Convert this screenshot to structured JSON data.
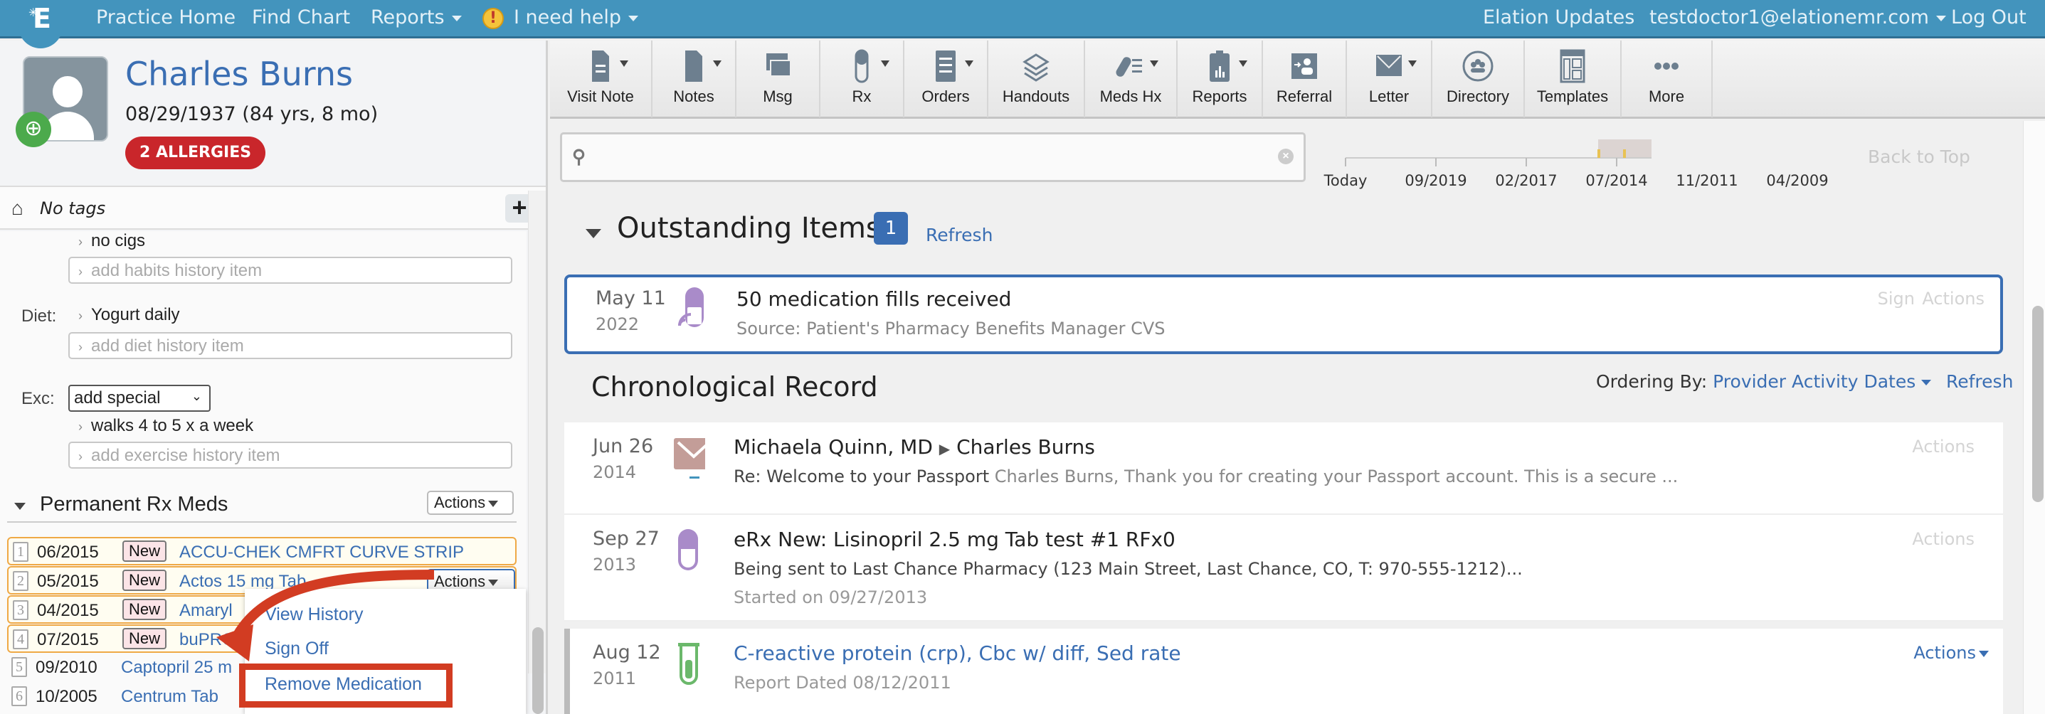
{
  "nav": {
    "logo": "Elation",
    "practice_home": "Practice Home",
    "find_chart": "Find Chart",
    "reports": "Reports",
    "help": "I need help",
    "updates": "Elation Updates",
    "user": "testdoctor1@elationemr.com",
    "logout": "Log Out"
  },
  "patient": {
    "name": "Charles Burns",
    "dob": "08/29/1937 (84 yrs, 8 mo)",
    "allergies": "2 ALLERGIES",
    "tags": "No tags"
  },
  "history": {
    "habits_item": "no cigs",
    "habits_placeholder": "add habits history item",
    "diet_label": "Diet:",
    "diet_item": "Yogurt daily",
    "diet_placeholder": "add diet history item",
    "exc_label": "Exc:",
    "exc_select": "add special",
    "exc_item": "walks 4 to 5 x a week",
    "exc_placeholder": "add exercise history item"
  },
  "rx_meds": {
    "title": "Permanent Rx Meds",
    "actions": "Actions",
    "items": [
      {
        "num": "1",
        "date": "06/2015",
        "badge": "New",
        "name": "ACCU-CHEK CMFRT CURVE STRIP"
      },
      {
        "num": "2",
        "date": "05/2015",
        "badge": "New",
        "name": "Actos 15 mg Tab"
      },
      {
        "num": "3",
        "date": "04/2015",
        "badge": "New",
        "name": "Amaryl"
      },
      {
        "num": "4",
        "date": "07/2015",
        "badge": "New",
        "name": "buPRO"
      },
      {
        "num": "5",
        "date": "09/2010",
        "badge": "",
        "name": "Captopril 25 m"
      },
      {
        "num": "6",
        "date": "10/2005",
        "badge": "",
        "name": "Centrum Tab"
      }
    ],
    "row_actions": "Actions",
    "menu": [
      "View History",
      "Sign Off",
      "Remove Medication"
    ]
  },
  "toolbar": [
    {
      "label": "Visit Note",
      "icon": "visit-note-icon",
      "dropdown": true
    },
    {
      "label": "Notes",
      "icon": "notes-icon",
      "dropdown": true
    },
    {
      "label": "Msg",
      "icon": "message-icon",
      "dropdown": false
    },
    {
      "label": "Rx",
      "icon": "pill-icon",
      "dropdown": true
    },
    {
      "label": "Orders",
      "icon": "orders-icon",
      "dropdown": true
    },
    {
      "label": "Handouts",
      "icon": "handouts-icon",
      "dropdown": false
    },
    {
      "label": "Meds Hx",
      "icon": "meds-history-icon",
      "dropdown": true
    },
    {
      "label": "Reports",
      "icon": "reports-icon",
      "dropdown": true
    },
    {
      "label": "Referral",
      "icon": "referral-icon",
      "dropdown": false
    },
    {
      "label": "Letter",
      "icon": "letter-icon",
      "dropdown": true
    },
    {
      "label": "Directory",
      "icon": "directory-icon",
      "dropdown": false
    },
    {
      "label": "Templates",
      "icon": "templates-icon",
      "dropdown": false
    },
    {
      "label": "More",
      "icon": "more-icon",
      "dropdown": false
    }
  ],
  "search": {
    "placeholder": "",
    "value": ""
  },
  "timeline": {
    "ticks": [
      "Today",
      "09/2019",
      "02/2017",
      "07/2014",
      "11/2011",
      "04/2009"
    ],
    "back_to_top": "Back to Top"
  },
  "outstanding": {
    "title": "Outstanding Items",
    "count": "1",
    "refresh": "Refresh",
    "item": {
      "date": "May 11",
      "year": "2022",
      "title": "50 medication fills received",
      "source": "Source: Patient's Pharmacy Benefits Manager CVS",
      "sign": "Sign",
      "actions": "Actions"
    }
  },
  "chronological": {
    "title": "Chronological Record",
    "ordering_label": "Ordering By:",
    "ordering_value": "Provider Activity Dates",
    "refresh": "Refresh",
    "items": [
      {
        "date": "Jun 26",
        "year": "2014",
        "from": "Michaela Quinn, MD",
        "to": "Charles Burns",
        "subject": "Re: Welcome to your Passport",
        "preview": "Charles Burns, Thank you for creating your Passport account. This is a secure ...",
        "actions": "Actions"
      },
      {
        "date": "Sep 27",
        "year": "2013",
        "title": "eRx New: Lisinopril 2.5 mg Tab test #1 RFx0",
        "detail": "Being sent to Last Chance Pharmacy (123 Main Street, Last Chance, CO, T: 970-555-1212)...",
        "started": "Started on 09/27/2013",
        "actions": "Actions"
      },
      {
        "date": "Aug 12",
        "year": "2011",
        "title": "C-reactive protein (crp), Cbc w/ diff, Sed rate",
        "detail": "Report Dated 08/12/2011",
        "actions": "Actions"
      }
    ]
  },
  "colors": {
    "nav_bg": "#4394bd",
    "link": "#3a6eb3",
    "allergy": "#c9262b",
    "new_row_border": "#efa946",
    "annotation": "#d23c22",
    "pill": "#a98bc9",
    "lab": "#6bb86b",
    "timeline_bar": "#e8c253"
  }
}
